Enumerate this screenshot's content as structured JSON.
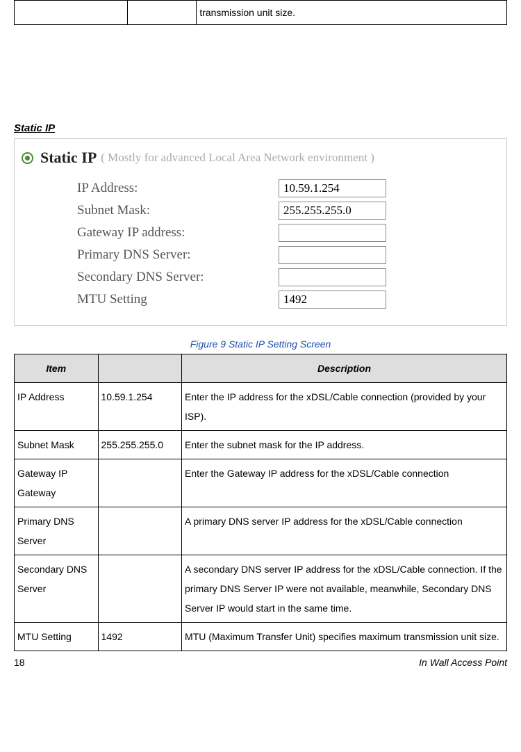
{
  "top_table": {
    "cell_text": "transmission unit size."
  },
  "section_heading": "Static IP",
  "form": {
    "radio_title": "Static IP",
    "radio_subtitle": "( Mostly for advanced Local Area Network environment )",
    "fields": [
      {
        "label": "IP Address:",
        "value": "10.59.1.254"
      },
      {
        "label": "Subnet Mask:",
        "value": "255.255.255.0"
      },
      {
        "label": "Gateway IP address:",
        "value": ""
      },
      {
        "label": "Primary DNS Server:",
        "value": ""
      },
      {
        "label": "Secondary DNS Server:",
        "value": ""
      },
      {
        "label": "MTU Setting",
        "value": "1492"
      }
    ]
  },
  "figure_caption": "Figure 9 Static IP Setting Screen",
  "desc_table": {
    "headers": {
      "item": "Item",
      "value": "",
      "desc": "Description"
    },
    "rows": [
      {
        "item": "IP Address",
        "value": "10.59.1.254",
        "desc": "Enter the IP address for the xDSL/Cable connection (provided by your ISP)."
      },
      {
        "item": "Subnet Mask",
        "value": "255.255.255.0",
        "desc": "Enter the subnet mask for the IP address."
      },
      {
        "item": "Gateway IP Gateway",
        "value": "",
        "desc": "Enter the Gateway IP address for the xDSL/Cable connection"
      },
      {
        "item": "Primary DNS Server",
        "value": "",
        "desc": "A primary DNS server IP address for the xDSL/Cable connection"
      },
      {
        "item": "Secondary DNS Server",
        "value": "",
        "desc": "A secondary DNS server IP address for the xDSL/Cable connection. If the primary DNS Server IP were not available, meanwhile, Secondary DNS Server IP would start in the same time."
      },
      {
        "item": "MTU Setting",
        "value": "1492",
        "desc": "MTU (Maximum Transfer Unit) specifies maximum transmission unit size."
      }
    ]
  },
  "footer": {
    "page": "18",
    "title": "In Wall Access Point"
  }
}
